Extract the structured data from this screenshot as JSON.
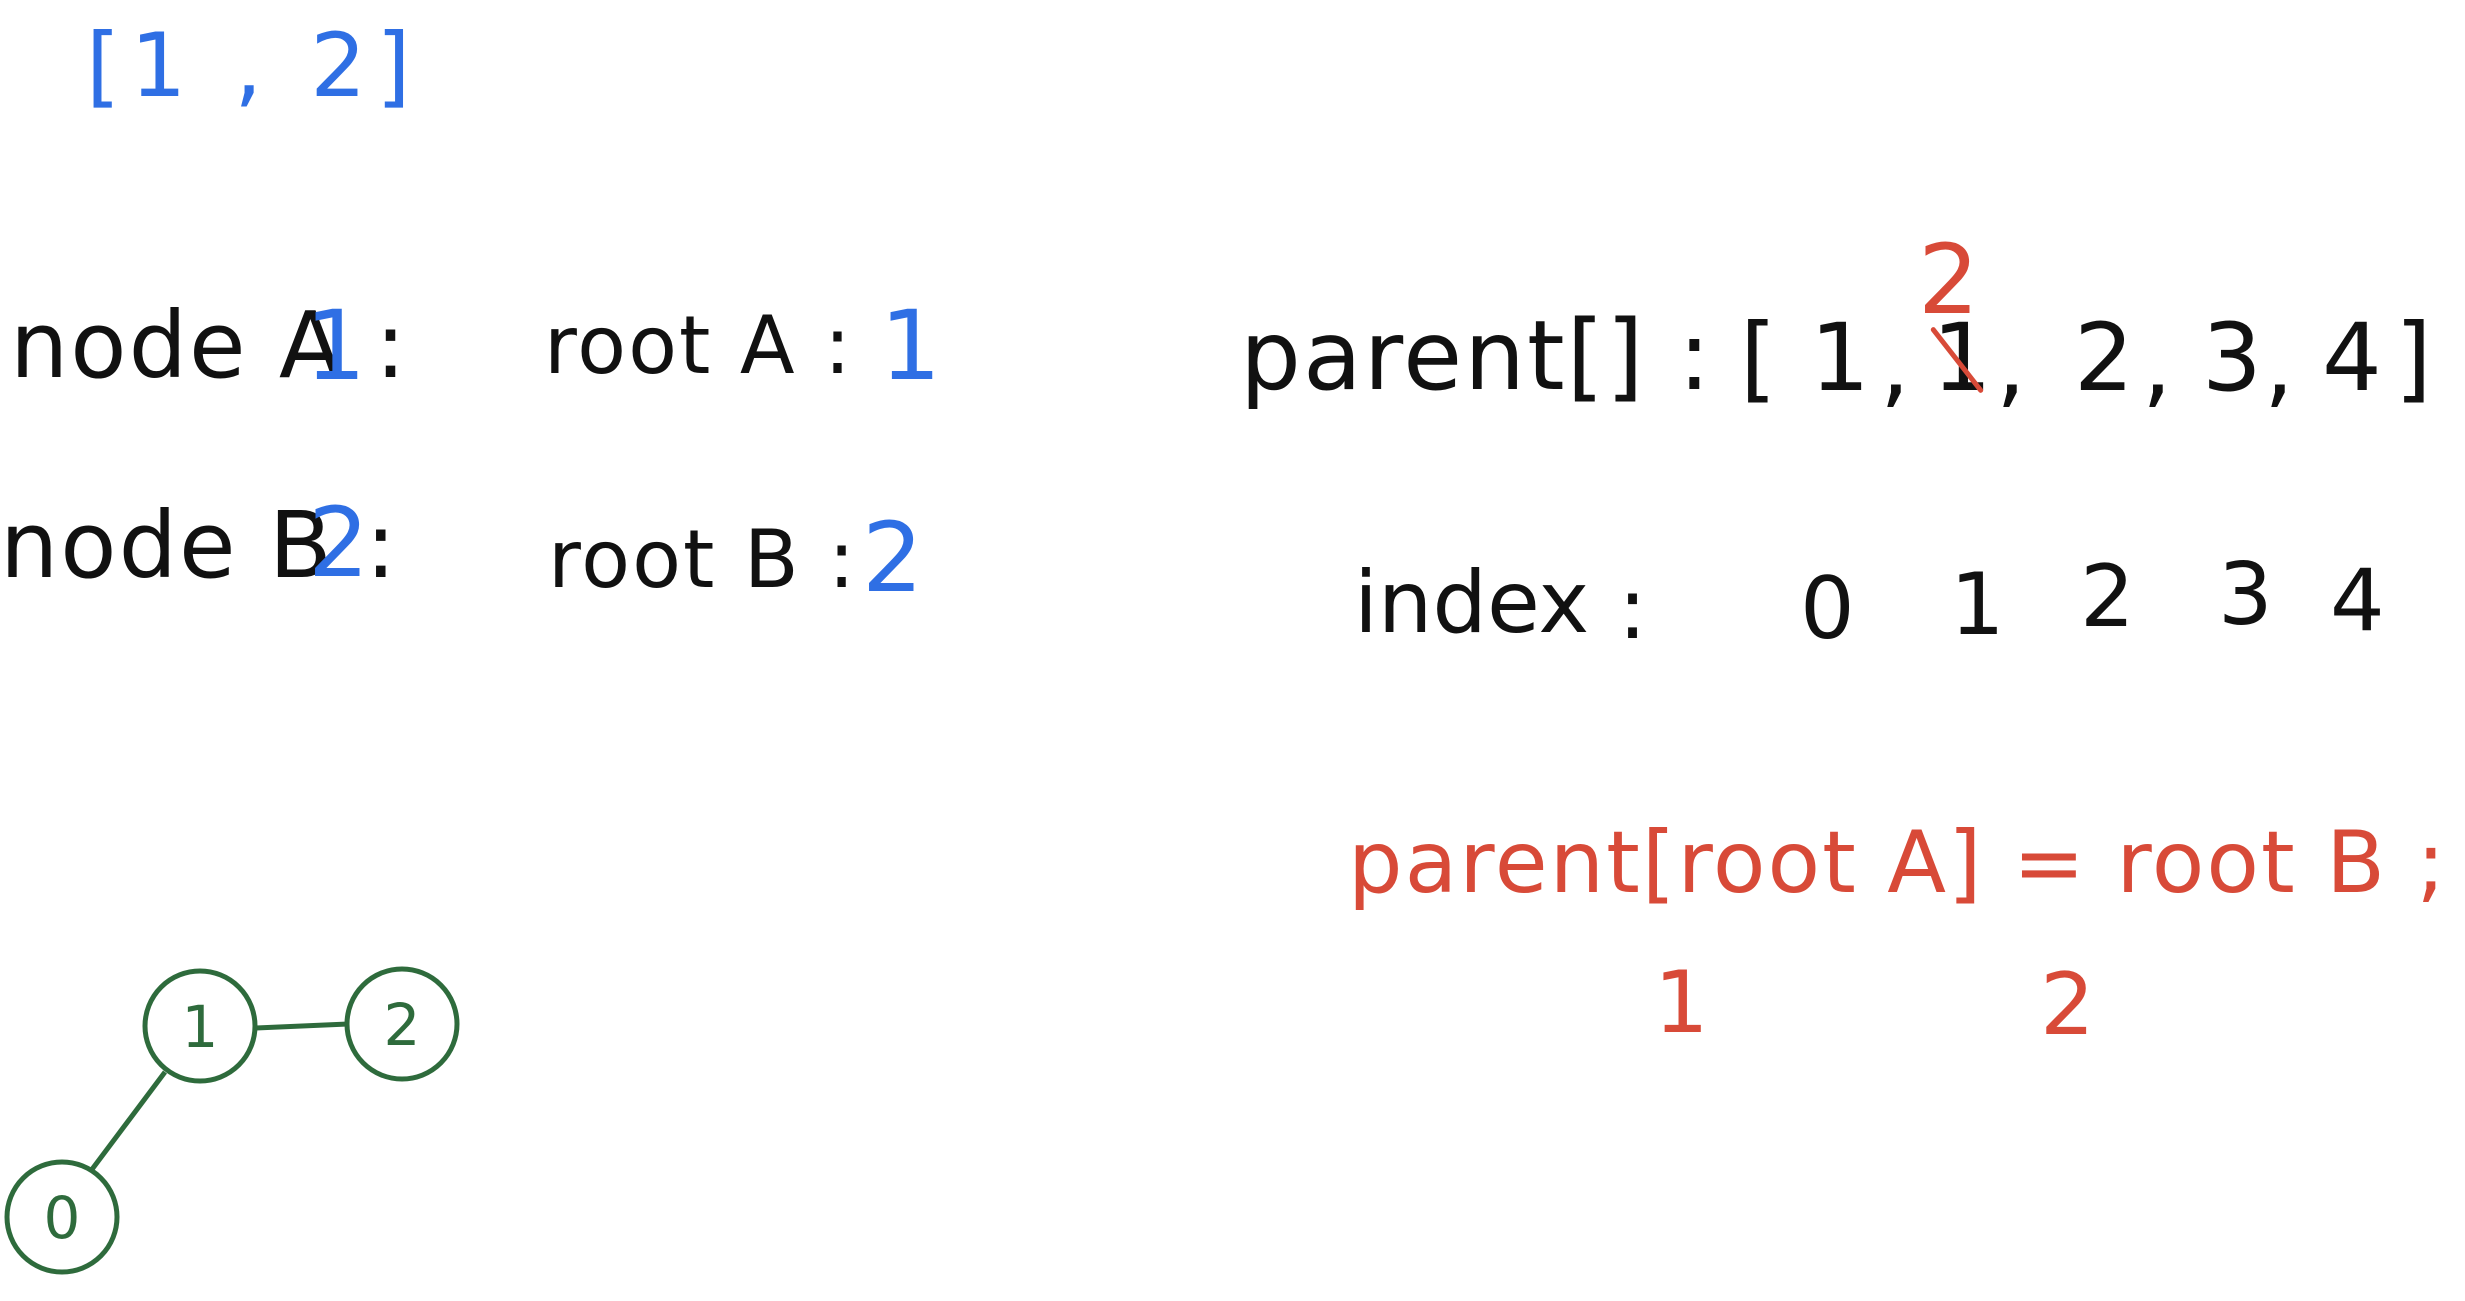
{
  "edge_pair": "[1 , 2]",
  "left_vars": {
    "node_a_label": "node A :",
    "node_a_value": "1",
    "root_a_label": "root A :",
    "root_a_value": "1",
    "node_b_label": "node B :",
    "node_b_value": "2",
    "root_b_label": "root B :",
    "root_b_value": "2"
  },
  "parent_array": {
    "label": "parent[] :",
    "open_bracket": "[",
    "elements": [
      "1",
      "1",
      "2",
      "3",
      "4"
    ],
    "separators": [
      ",",
      ",",
      ",",
      ","
    ],
    "close_bracket": "]",
    "replacement": "2"
  },
  "index_row": {
    "label": "index",
    "colon": ":",
    "values": [
      "0",
      "1",
      "2",
      "3",
      "4"
    ]
  },
  "assignment": {
    "text": "parent[root A] = root B ;",
    "left_value": "1",
    "right_value": "2"
  },
  "graph": {
    "nodes": [
      "0",
      "1",
      "2"
    ],
    "edges": [
      [
        "1",
        "2"
      ],
      [
        "1",
        "0"
      ]
    ],
    "stroke_color": "#2e6b3c"
  },
  "colors": {
    "blue": "#2f6fe4",
    "red": "#d84a38",
    "black": "#111111",
    "green": "#2e6b3c"
  }
}
